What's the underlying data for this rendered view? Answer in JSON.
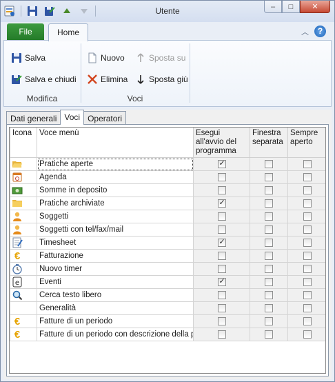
{
  "window": {
    "title": "Utente"
  },
  "ribbon_tabs": {
    "file": "File",
    "home": "Home"
  },
  "ribbon": {
    "modifica": {
      "label": "Modifica",
      "salva": "Salva",
      "salva_chiudi": "Salva e chiudi"
    },
    "voci": {
      "label": "Voci",
      "nuovo": "Nuovo",
      "sposta_su": "Sposta su",
      "elimina": "Elimina",
      "sposta_giu": "Sposta giù"
    }
  },
  "content_tabs": [
    "Dati generali",
    "Voci",
    "Operatori"
  ],
  "table": {
    "headers": {
      "icona": "Icona",
      "voce": "Voce menù",
      "esegui": "Esegui all'avvio del programma",
      "finestra": "Finestra separata",
      "sempre": "Sempre aperto"
    },
    "rows": [
      {
        "icon": "open-folder-icon",
        "label": "Pratiche aperte",
        "esegui": true,
        "finestra": false,
        "sempre": false
      },
      {
        "icon": "agenda-icon",
        "label": "Agenda",
        "esegui": false,
        "finestra": false,
        "sempre": false
      },
      {
        "icon": "money-icon",
        "label": "Somme in deposito",
        "esegui": false,
        "finestra": false,
        "sempre": false
      },
      {
        "icon": "folder-icon",
        "label": "Pratiche archiviate",
        "esegui": true,
        "finestra": false,
        "sempre": false
      },
      {
        "icon": "person-icon",
        "label": "Soggetti",
        "esegui": false,
        "finestra": false,
        "sempre": false
      },
      {
        "icon": "person-icon",
        "label": "Soggetti con tel/fax/mail",
        "esegui": false,
        "finestra": false,
        "sempre": false
      },
      {
        "icon": "timesheet-icon",
        "label": "Timesheet",
        "esegui": true,
        "finestra": false,
        "sempre": false
      },
      {
        "icon": "euro-icon",
        "label": "Fatturazione",
        "esegui": false,
        "finestra": false,
        "sempre": false
      },
      {
        "icon": "timer-icon",
        "label": "Nuovo timer",
        "esegui": false,
        "finestra": false,
        "sempre": false
      },
      {
        "icon": "events-icon",
        "label": "Eventi",
        "esegui": true,
        "finestra": false,
        "sempre": false
      },
      {
        "icon": "search-icon",
        "label": "Cerca testo libero",
        "esegui": false,
        "finestra": false,
        "sempre": false
      },
      {
        "icon": "",
        "label": "Generalità",
        "esegui": false,
        "finestra": false,
        "sempre": false
      },
      {
        "icon": "euro-icon",
        "label": "Fatture di un periodo",
        "esegui": false,
        "finestra": false,
        "sempre": false
      },
      {
        "icon": "euro-icon",
        "label": "Fatture di un periodo con descrizione della prim",
        "esegui": false,
        "finestra": false,
        "sempre": false
      }
    ]
  }
}
